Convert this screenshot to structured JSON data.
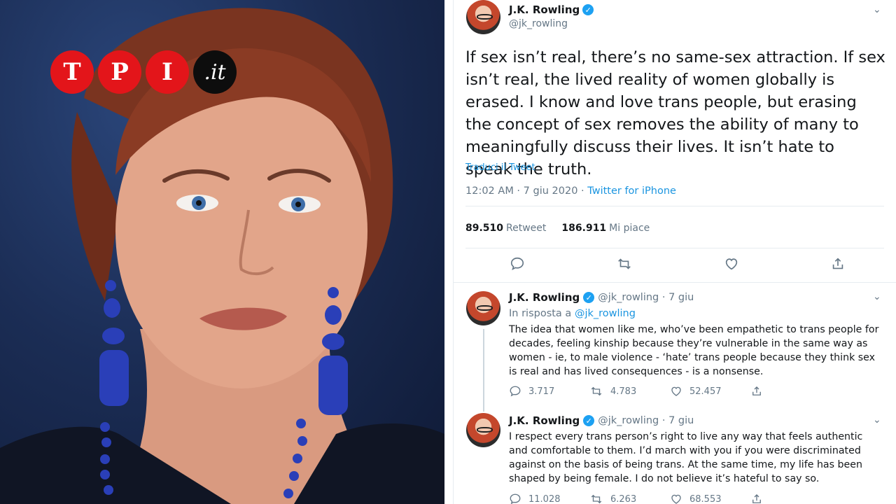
{
  "logo": {
    "letters": [
      "T",
      "P",
      "I"
    ],
    "suffix": ".it"
  },
  "main_tweet": {
    "author_name": "J.K. Rowling",
    "handle": "@jk_rowling",
    "text": "If sex isn’t real, there’s no same-sex attraction. If sex isn’t real, the lived reality of women globally is erased. I know and love trans people, but erasing the concept of sex removes the ability of many to meaningfully discuss their lives. It isn’t hate to speak the truth.",
    "translate_label": "Traduci il Tweet",
    "timestamp": "12:02 AM · 7 giu 2020 · ",
    "source": "Twitter for iPhone",
    "retweets_count": "89.510",
    "retweets_label": "Retweet",
    "likes_count": "186.911",
    "likes_label": "Mi piace",
    "icons": {
      "reply": "reply-icon",
      "retweet": "retweet-icon",
      "like": "heart-icon",
      "share": "share-icon"
    }
  },
  "replies": [
    {
      "author_name": "J.K. Rowling",
      "handle_date": "@jk_rowling · 7 giu",
      "in_reply_prefix": "In risposta a ",
      "in_reply_handle": "@jk_rowling",
      "text": "The idea that women like me, who’ve been empathetic to trans people for decades, feeling kinship because they’re vulnerable in the same way as women - ie, to male violence - ‘hate’ trans people because they think sex is real and has lived consequences - is a nonsense.",
      "replies_count": "3.717",
      "retweets_count": "4.783",
      "likes_count": "52.457"
    },
    {
      "author_name": "J.K. Rowling",
      "handle_date": "@jk_rowling · 7 giu",
      "text": "I respect every trans person’s right to live any way that feels authentic and comfortable to them. I’d march with you if you were discriminated against on the basis of being trans. At the same time, my life has been shaped by being female. I do not believe it’s hateful to say so.",
      "replies_count": "11.028",
      "retweets_count": "6.263",
      "likes_count": "68.553"
    }
  ],
  "colors": {
    "accent": "#1da1f2",
    "link": "#1b95e0",
    "muted": "#657786",
    "logo_red": "#e3151a"
  }
}
